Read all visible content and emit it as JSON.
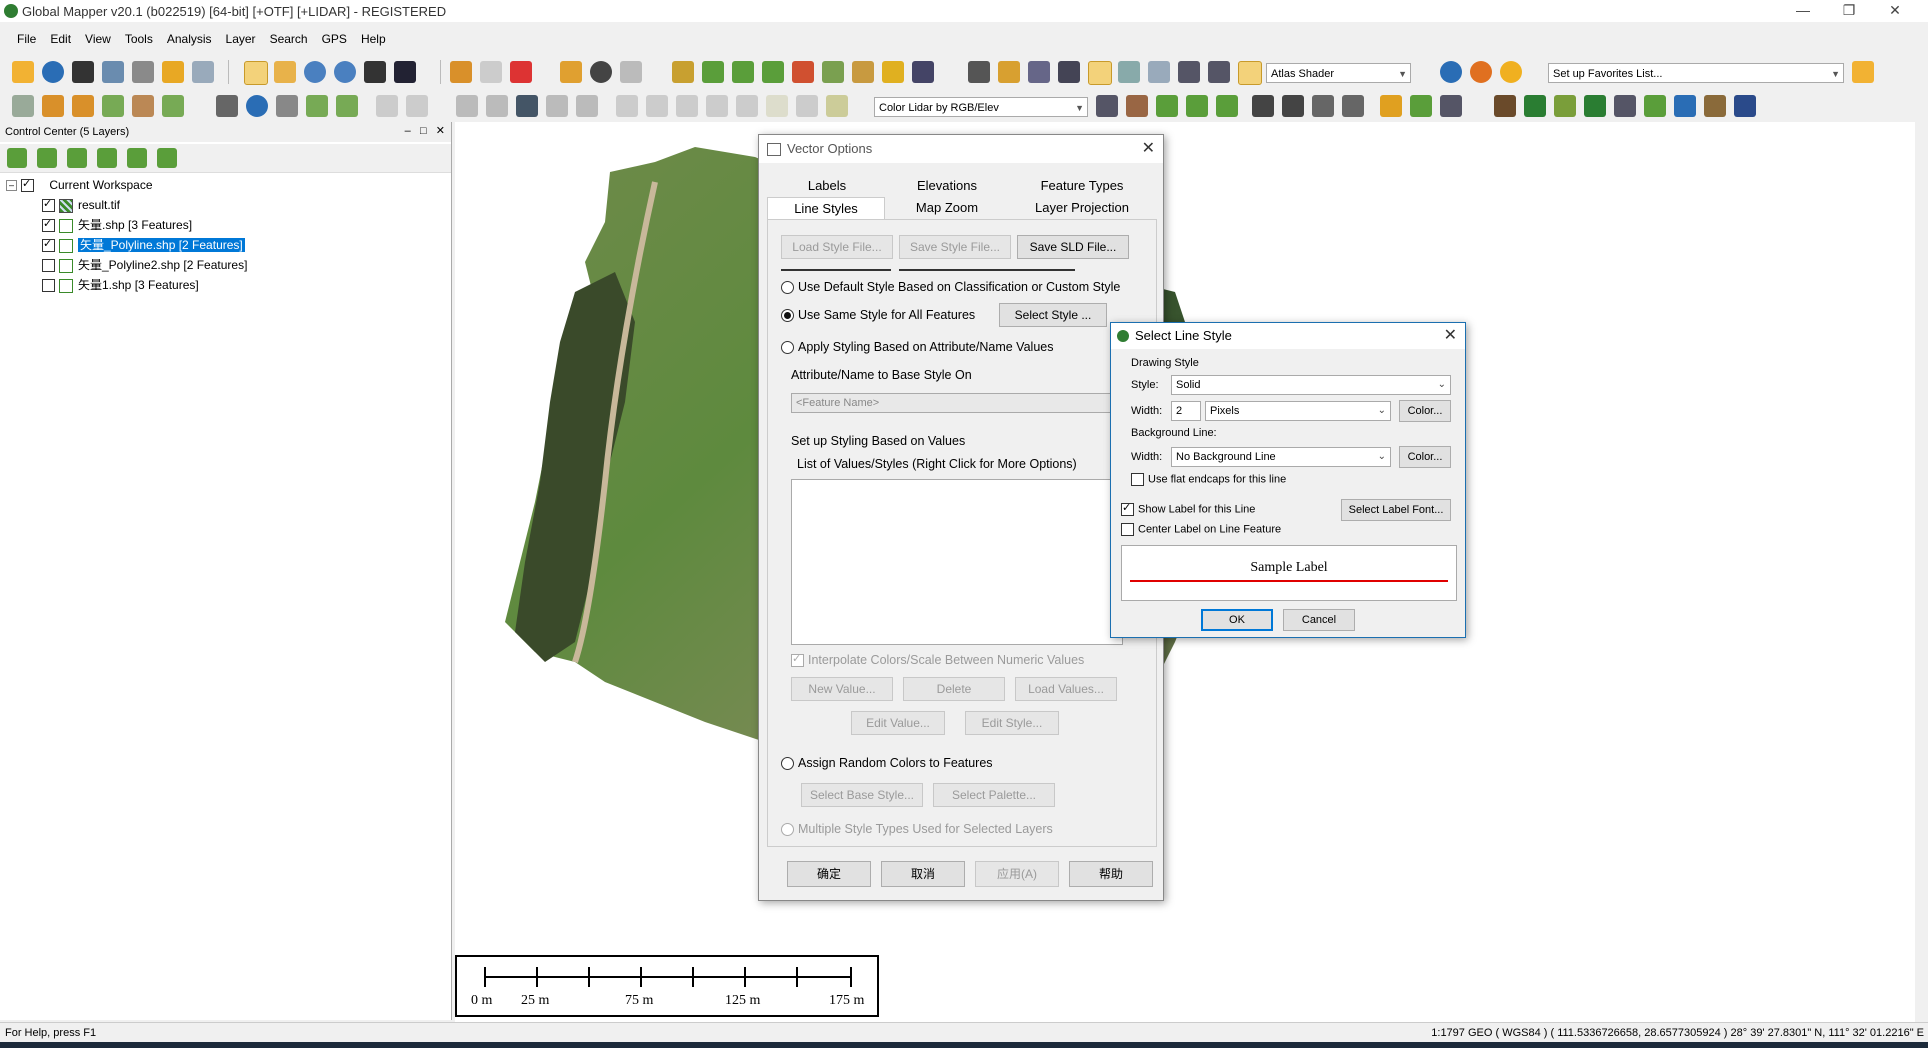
{
  "app": {
    "title": "Global Mapper v20.1 (b022519) [64-bit] [+OTF] [+LIDAR] - REGISTERED",
    "win_min": "—",
    "win_restore": "❐",
    "win_close": "✕"
  },
  "menu": [
    "File",
    "Edit",
    "View",
    "Tools",
    "Analysis",
    "Layer",
    "Search",
    "GPS",
    "Help"
  ],
  "toolbar": {
    "shader": "Atlas Shader",
    "favorites": "Set up Favorites List...",
    "lidar_color": "Color Lidar by RGB/Elev"
  },
  "control_center": {
    "title": "Control Center (5 Layers)",
    "btn_min": "–",
    "btn_max": "□",
    "btn_close": "✕",
    "workspace": "Current Workspace",
    "layers": [
      {
        "name": "result.tif",
        "checked": true
      },
      {
        "name": "矢量.shp [3 Features]",
        "checked": true
      },
      {
        "name": "矢量_Polyline.shp [2 Features]",
        "checked": true,
        "selected": true
      },
      {
        "name": "矢量_Polyline2.shp [2 Features]",
        "checked": false
      },
      {
        "name": "矢量1.shp [3 Features]",
        "checked": false
      }
    ]
  },
  "scale_bar": {
    "labels": [
      "0 m",
      "25 m",
      "75 m",
      "125 m",
      "175 m"
    ]
  },
  "status": {
    "help": "For Help, press F1",
    "coords": "1:1797  GEO ( WGS84 ) ( 111.5336726658, 28.6577305924 )  28° 39' 27.8301\" N, 111° 32' 01.2216\" E"
  },
  "vector_options": {
    "title": "Vector Options",
    "tabs_row1": [
      "Labels",
      "Elevations",
      "Feature Types"
    ],
    "tabs_row2": [
      "Line Styles",
      "Map Zoom",
      "Layer Projection"
    ],
    "load_style": "Load Style File...",
    "save_style": "Save Style File...",
    "save_sld": "Save SLD File...",
    "opt_default": "Use Default Style Based on Classification or Custom Style",
    "opt_same": "Use Same Style for All Features",
    "select_style": "Select Style ...",
    "opt_attr": "Apply Styling Based on Attribute/Name Values",
    "attr_label": "Attribute/Name to Base Style On",
    "attr_value": "<Feature Name>",
    "values_header": "Set up Styling Based on Values",
    "list_label": "List of Values/Styles (Right Click for More Options)",
    "interpolate": "Interpolate Colors/Scale Between Numeric Values",
    "new_value": "New Value...",
    "delete": "Delete",
    "load_values": "Load Values...",
    "edit_value": "Edit Value...",
    "edit_style": "Edit Style...",
    "opt_random": "Assign Random Colors to Features",
    "select_base": "Select Base Style...",
    "select_palette": "Select Palette...",
    "opt_multiple": "Multiple Style Types Used for Selected Layers",
    "ok": "确定",
    "cancel": "取消",
    "apply": "应用(A)",
    "help": "帮助"
  },
  "line_style": {
    "title": "Select Line Style",
    "drawing_style": "Drawing Style",
    "style_label": "Style:",
    "style_value": "Solid",
    "width_label": "Width:",
    "width_value": "2",
    "units": "Pixels",
    "color_btn": "Color...",
    "background_line": "Background Line:",
    "bg_width_label": "Width:",
    "bg_value": "No Background Line",
    "bg_color_btn": "Color...",
    "flat_endcaps": "Use flat endcaps for this line",
    "show_label": "Show Label for this Line",
    "center_label": "Center Label on Line Feature",
    "select_font": "Select Label Font...",
    "sample": "Sample Label",
    "ok": "OK",
    "cancel": "Cancel"
  },
  "colors": {
    "selection": "#0078d7",
    "sample_line": "#e00000",
    "app_icon": "#2f7d32"
  }
}
